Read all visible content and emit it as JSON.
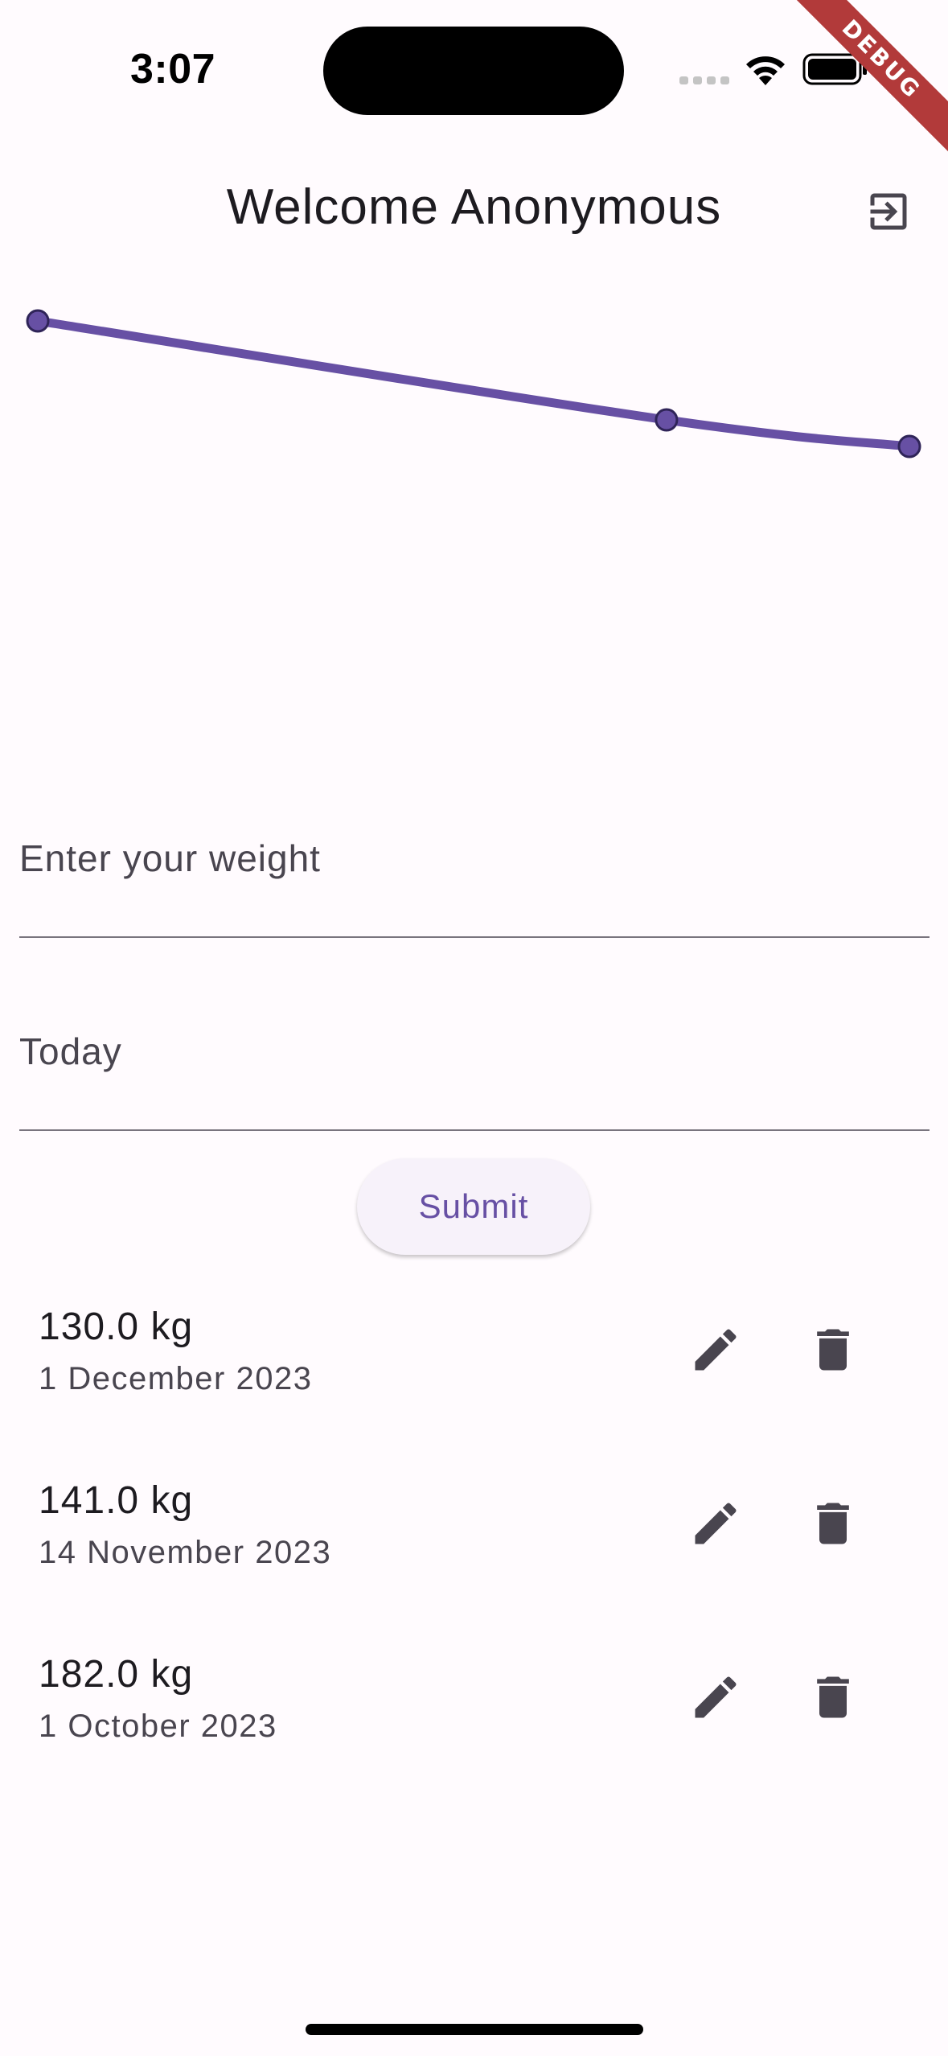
{
  "status_bar": {
    "time": "3:07",
    "debug_label": "DEBUG"
  },
  "header": {
    "title": "Welcome Anonymous",
    "logout_icon": "logout-icon"
  },
  "chart_data": {
    "type": "line",
    "x": [
      "1 October 2023",
      "14 November 2023",
      "1 December 2023"
    ],
    "series": [
      {
        "values": [
          182.0,
          141.0,
          130.0
        ]
      }
    ],
    "title": "",
    "xlabel": "",
    "ylabel": "",
    "grid": false,
    "color": "#6750a4"
  },
  "form": {
    "weight_placeholder": "Enter your weight",
    "weight_value": "",
    "date_value": "Today",
    "submit_label": "Submit"
  },
  "entries": [
    {
      "weight": "130.0 kg",
      "date": "1 December 2023"
    },
    {
      "weight": "141.0 kg",
      "date": "14 November 2023"
    },
    {
      "weight": "182.0 kg",
      "date": "1 October 2023"
    }
  ],
  "icons": {
    "edit": "pencil-icon",
    "delete": "trash-icon"
  },
  "colors": {
    "accent": "#6750a4",
    "background": "#fffbfe",
    "icon": "#49454f"
  }
}
